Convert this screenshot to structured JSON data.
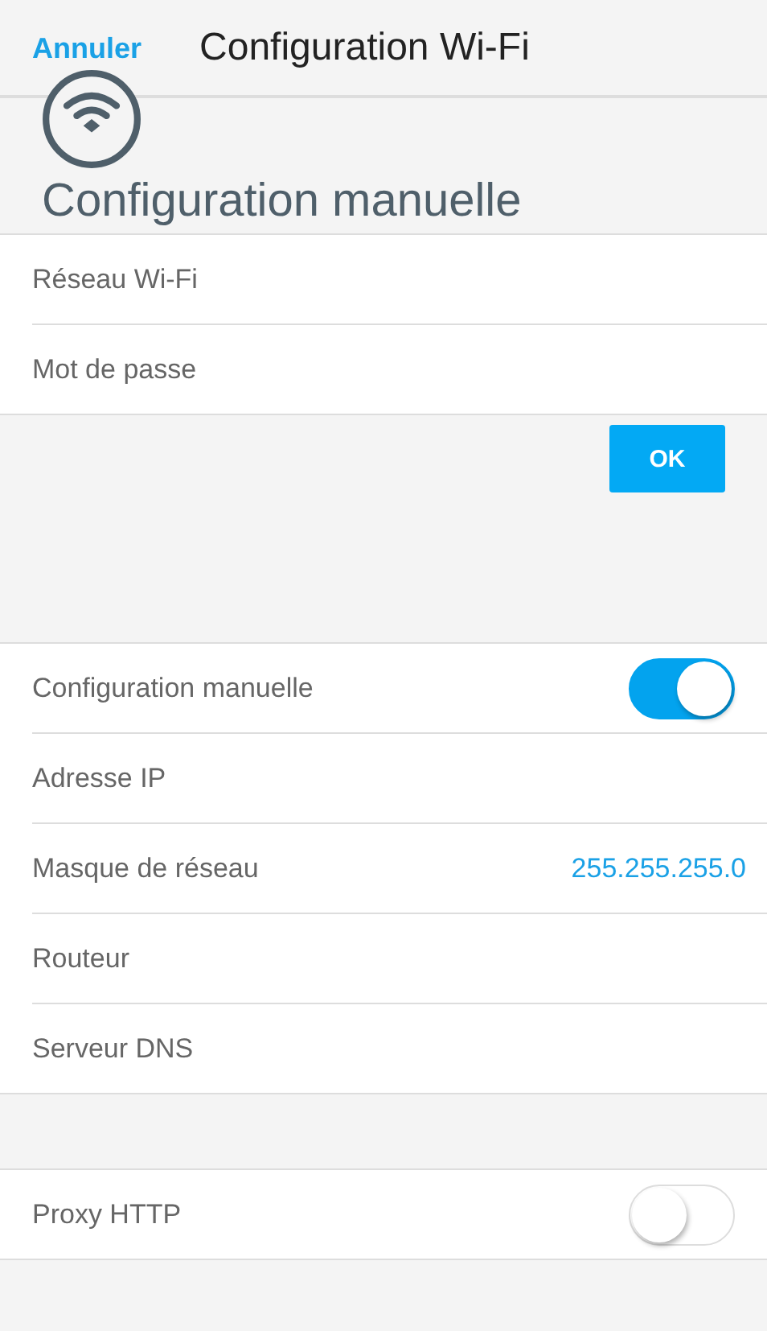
{
  "header": {
    "cancel": "Annuler",
    "title": "Configuration Wi-Fi"
  },
  "heading": "Configuration manuelle",
  "fields": [
    {
      "placeholder": "Réseau Wi-Fi"
    },
    {
      "placeholder": "Mot de passe"
    }
  ],
  "ok_button": "OK",
  "settings": [
    {
      "kind": "toggle",
      "label": "Configuration manuelle",
      "on": true
    },
    {
      "kind": "plain",
      "label": "Adresse IP"
    },
    {
      "kind": "value",
      "label": "Masque de réseau",
      "value": "255.255.255.0"
    },
    {
      "kind": "plain",
      "label": "Routeur"
    },
    {
      "kind": "plain",
      "label": "Serveur DNS"
    }
  ],
  "proxy": [
    {
      "kind": "toggle",
      "label": "Proxy HTTP",
      "on": false
    }
  ]
}
